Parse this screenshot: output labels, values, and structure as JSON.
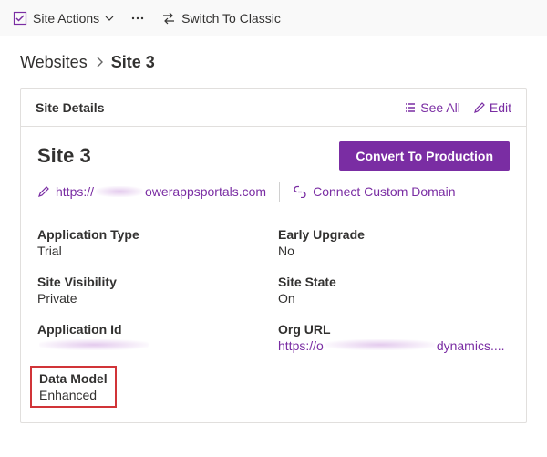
{
  "topbar": {
    "site_actions": "Site Actions",
    "switch_classic": "Switch To Classic"
  },
  "breadcrumb": {
    "root": "Websites",
    "current": "Site 3"
  },
  "card": {
    "title": "Site Details",
    "see_all": "See All",
    "edit": "Edit"
  },
  "site": {
    "name": "Site 3",
    "convert_btn": "Convert To Production",
    "url_prefix": "https://",
    "url_suffix": "owerappsportals.com",
    "connect_domain": "Connect Custom Domain"
  },
  "fields": {
    "application_type": {
      "label": "Application Type",
      "value": "Trial"
    },
    "early_upgrade": {
      "label": "Early Upgrade",
      "value": "No"
    },
    "site_visibility": {
      "label": "Site Visibility",
      "value": "Private"
    },
    "site_state": {
      "label": "Site State",
      "value": "On"
    },
    "application_id": {
      "label": "Application Id",
      "value": ""
    },
    "org_url": {
      "label": "Org URL",
      "prefix": "https://o",
      "suffix": "dynamics...."
    },
    "data_model": {
      "label": "Data Model",
      "value": "Enhanced"
    }
  }
}
